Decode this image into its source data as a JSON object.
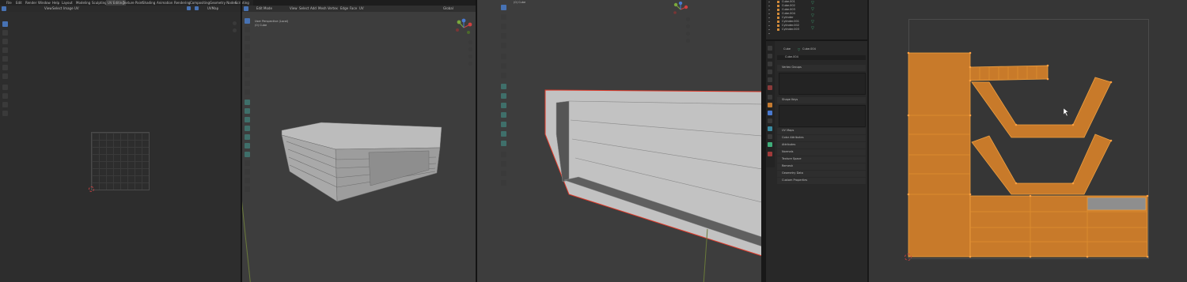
{
  "app": {
    "menus": [
      "File",
      "Edit",
      "Render",
      "Window",
      "Help"
    ],
    "workspace_tabs": [
      "Layout",
      "Modeling",
      "Sculpting",
      "UV Editing",
      "Texture Paint",
      "Shading",
      "Animation",
      "Rendering",
      "Compositing",
      "Geometry Nodes",
      "Scripting"
    ],
    "active_tab": "UV Editing"
  },
  "uv_editor": {
    "header": [
      "View",
      "Select",
      "Image",
      "UV"
    ],
    "uvmap": "UVMap"
  },
  "viewport1": {
    "mode": "Edit Mode",
    "header": [
      "View",
      "Select",
      "Add",
      "Mesh",
      "Vertex",
      "Edge",
      "Face",
      "UV"
    ],
    "transform": "Global",
    "overlay_line1": "User Perspective (Local)",
    "overlay_line2": "(0) Cube"
  },
  "viewport2": {
    "overlay": "(0) Cube"
  },
  "outliner": {
    "items": [
      "Cube.001",
      "Cube.002",
      "Cube.003",
      "Cube.004",
      "Cylinder",
      "Cylinder.001",
      "Cylinder.002",
      "Cylinder.003"
    ]
  },
  "properties": {
    "breadcrumb_object": "Cube",
    "breadcrumb_mesh": "Cube.004",
    "mesh_name": "Cube.004",
    "sections": {
      "vertex_groups": "Vertex Groups",
      "shape_keys": "Shape Keys",
      "uv_maps": "UV Maps",
      "color_attributes": "Color Attributes",
      "attributes": "Attributes",
      "normals": "Normals",
      "texture_space": "Texture Space",
      "remesh": "Remesh",
      "geometry_data": "Geometry Data",
      "custom_properties": "Custom Properties"
    },
    "uv_maps_label": "UV Maps"
  },
  "colors": {
    "uv_orange": "#c87a2a",
    "selection_red": "#e03a2a",
    "active_blue": "#4772b3",
    "viewport_bg": "#3d3d3d"
  }
}
